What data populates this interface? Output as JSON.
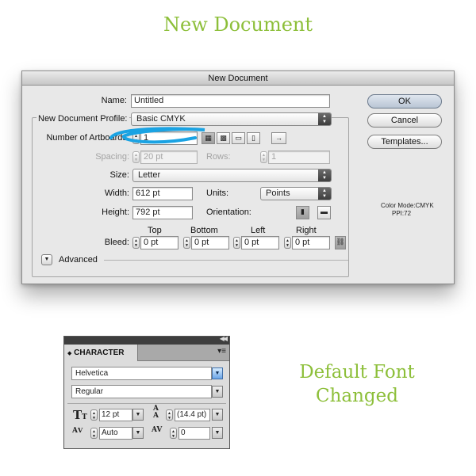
{
  "headings": {
    "top": "New Document",
    "bottom_line1": "Default Font",
    "bottom_line2": "Changed"
  },
  "dialog": {
    "title": "New Document",
    "name_label": "Name:",
    "name_value": "Untitled",
    "profile_label": "New Document Profile:",
    "profile_value": "Basic CMYK",
    "artboards_label": "Number of Artboards:",
    "artboards_value": "1",
    "spacing_label": "Spacing:",
    "spacing_value": "20 pt",
    "rows_label": "Rows:",
    "rows_value": "1",
    "size_label": "Size:",
    "size_value": "Letter",
    "width_label": "Width:",
    "width_value": "612 pt",
    "units_label": "Units:",
    "units_value": "Points",
    "height_label": "Height:",
    "height_value": "792 pt",
    "orientation_label": "Orientation:",
    "bleed_label": "Bleed:",
    "bleed_headers": {
      "top": "Top",
      "bottom": "Bottom",
      "left": "Left",
      "right": "Right"
    },
    "bleed_values": {
      "top": "0 pt",
      "bottom": "0 pt",
      "left": "0 pt",
      "right": "0 pt"
    },
    "advanced_label": "Advanced",
    "ok_label": "OK",
    "cancel_label": "Cancel",
    "templates_label": "Templates...",
    "color_mode": "Color Mode:CMYK",
    "ppi": "PPI:72"
  },
  "character": {
    "tab_label": "CHARACTER",
    "font_family": "Helvetica",
    "font_style": "Regular",
    "font_size": "12 pt",
    "leading": "(14.4 pt)",
    "kerning": "Auto",
    "tracking": "0"
  },
  "colors": {
    "heading_green": "#8dbf3a",
    "annotation_blue": "#1aa3e3"
  }
}
